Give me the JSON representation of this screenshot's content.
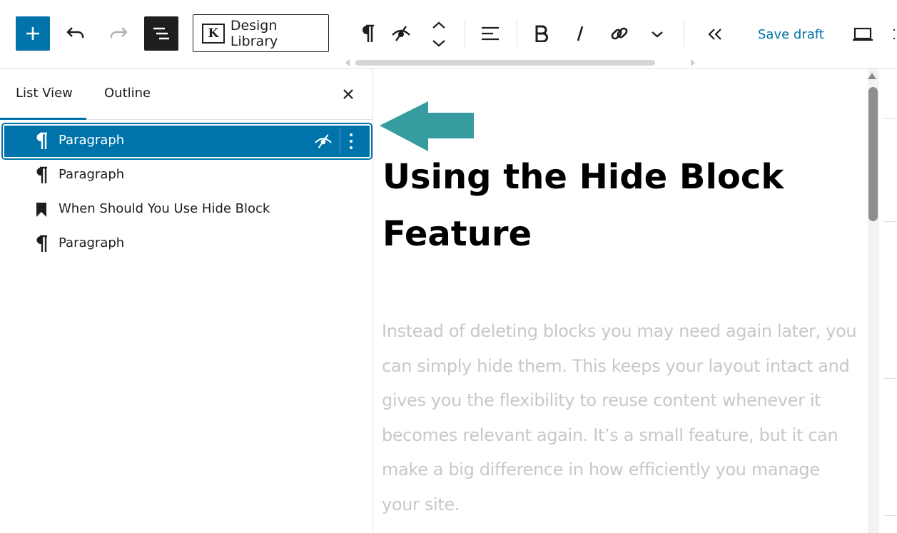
{
  "toolbar": {
    "design_library_label": "Design Library",
    "design_library_logo": "K",
    "save_draft_label": "Save draft",
    "icons": [
      "plus-icon",
      "undo-icon",
      "redo-icon",
      "list-view-icon",
      "paragraph-icon",
      "hide-icon",
      "move-arrows-icon",
      "align-icon",
      "bold-icon",
      "italic-icon",
      "link-icon",
      "chevron-down-icon",
      "collapse-icon",
      "desktop-preview-icon"
    ]
  },
  "sidebar": {
    "tabs": [
      {
        "label": "List View",
        "active": true
      },
      {
        "label": "Outline",
        "active": false
      }
    ],
    "items": [
      {
        "label": "Paragraph",
        "icon": "paragraph-icon",
        "selected": true
      },
      {
        "label": "Paragraph",
        "icon": "paragraph-icon",
        "selected": false
      },
      {
        "label": "When Should You Use Hide Block",
        "icon": "bookmark-icon",
        "selected": false
      },
      {
        "label": "Paragraph",
        "icon": "paragraph-icon",
        "selected": false
      }
    ]
  },
  "content": {
    "heading_line1": "Using the Hide Block",
    "heading_line2": "Feature",
    "paragraph": "Instead of deleting blocks you may need again later, you can simply hide them. This keeps your layout intact and gives you the flexibility to reuse content whenever it becomes relevant again. It’s a small feature, but it can make a big difference in how efficiently you manage your site."
  },
  "colors": {
    "accent": "#0073aa",
    "arrow": "#369ca0",
    "hidden_text": "#c8c8c8"
  }
}
